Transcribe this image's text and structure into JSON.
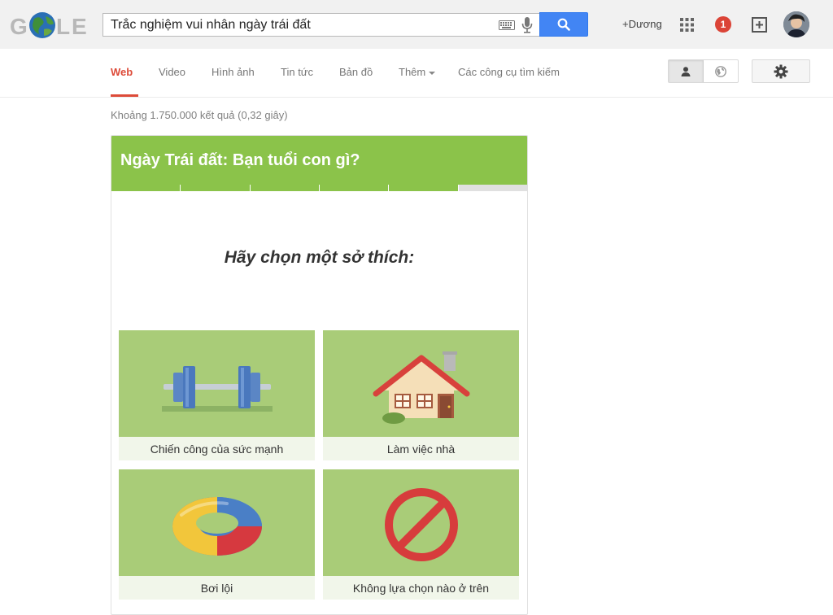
{
  "header": {
    "logo_letters": [
      "G",
      "L",
      "E"
    ],
    "search": {
      "value": "Trắc nghiệm vui nhân ngày trái đất",
      "placeholder": ""
    },
    "user_link": "+Dương",
    "notification_count": "1"
  },
  "nav": {
    "tabs": [
      {
        "label": "Web",
        "active": true
      },
      {
        "label": "Video"
      },
      {
        "label": "Hình ảnh"
      },
      {
        "label": "Tin tức"
      },
      {
        "label": "Bản đồ"
      },
      {
        "label": "Thêm"
      },
      {
        "label": "Các công cụ tìm kiếm"
      }
    ]
  },
  "results": {
    "stats": "Khoảng 1.750.000 kết quả (0,32 giây)"
  },
  "quiz": {
    "title": "Ngày Trái đất: Bạn tuổi con gì?",
    "progress": {
      "completed_steps": 5,
      "total_steps": 6
    },
    "prompt": "Hãy chọn một sở thích:",
    "options": [
      {
        "label": "Chiến công của sức mạnh",
        "icon": "dumbbell-icon"
      },
      {
        "label": "Làm việc nhà",
        "icon": "house-icon"
      },
      {
        "label": "Bơi lội",
        "icon": "swim-ring-icon"
      },
      {
        "label": "Không lựa chọn nào ở trên",
        "icon": "no-entry-icon"
      }
    ]
  },
  "colors": {
    "quiz_green": "#8bc34a",
    "option_green": "#a9cc78",
    "search_blue": "#4285f4",
    "nav_active_red": "#dd4b39",
    "notification_red": "#db4437"
  }
}
